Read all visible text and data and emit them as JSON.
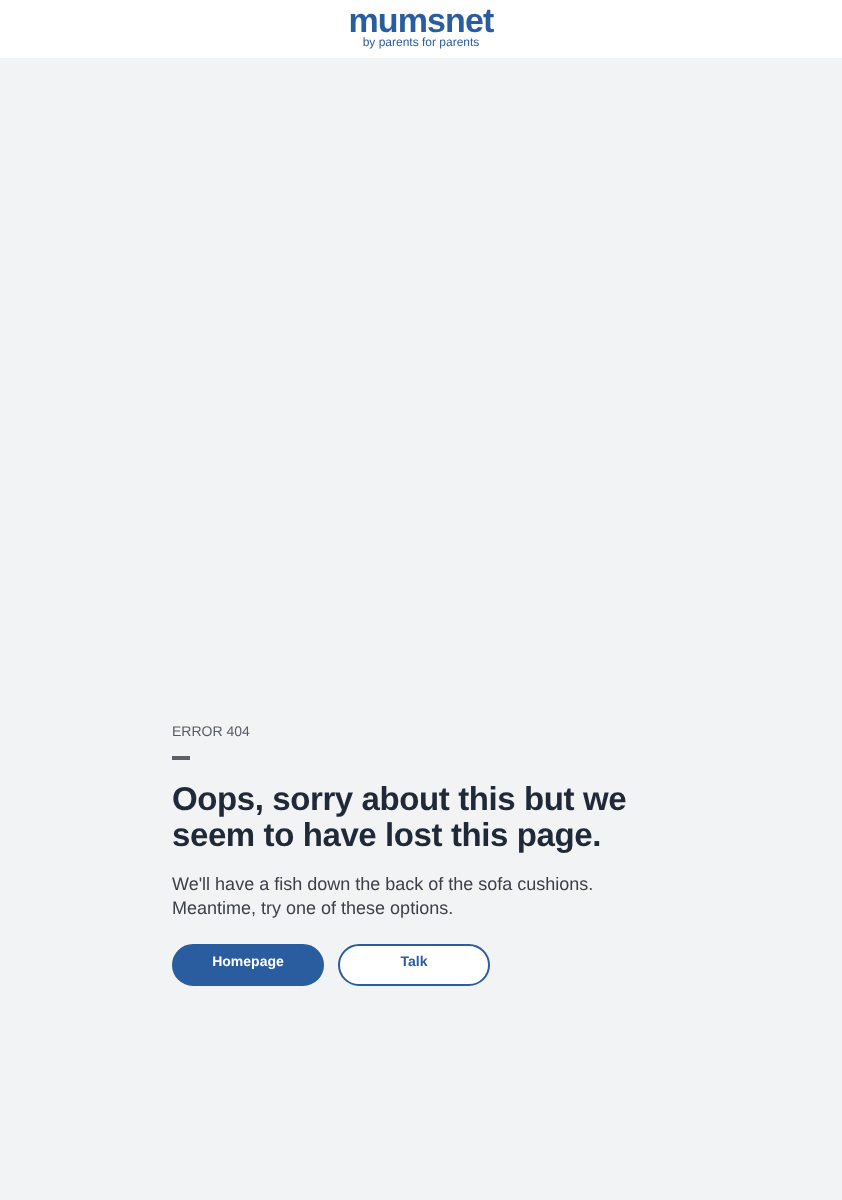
{
  "header": {
    "logo": "mumsnet",
    "tagline": "by parents for parents"
  },
  "error": {
    "code": "ERROR 404",
    "heading": "Oops, sorry about this but we seem to have lost this page.",
    "message": "We'll have a fish down the back of the sofa cushions. Meantime, try one of these options."
  },
  "buttons": [
    {
      "label": "Homepage",
      "kind": "primary"
    },
    {
      "label": "Talk",
      "kind": "secondary"
    }
  ]
}
